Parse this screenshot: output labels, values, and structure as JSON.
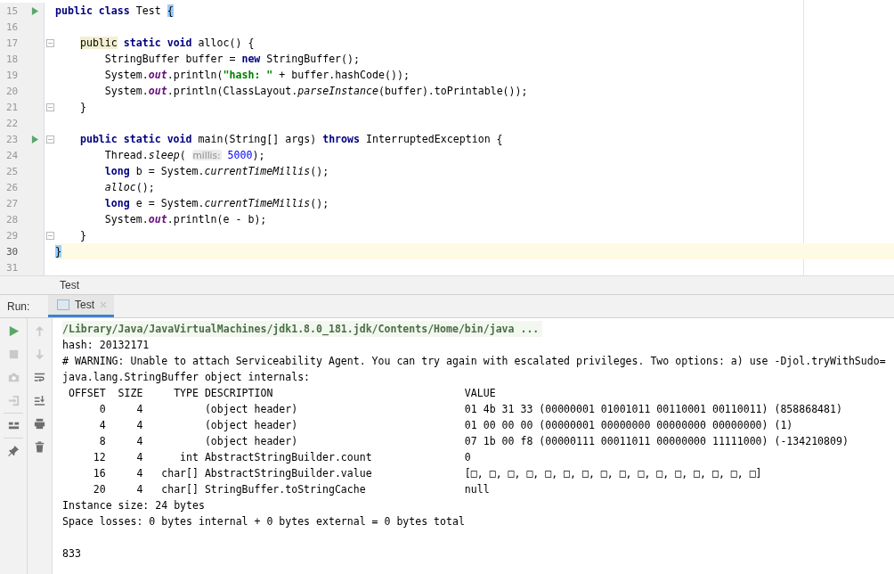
{
  "editor": {
    "lines": [
      {
        "number": "15",
        "run": true,
        "fold": false,
        "current": false,
        "segments": [
          {
            "kind": "kw",
            "text": "public class"
          },
          {
            "kind": "plain",
            "text": " Test "
          },
          {
            "kind": "match",
            "text": "{"
          }
        ]
      },
      {
        "number": "16",
        "run": false,
        "fold": false,
        "current": false
      },
      {
        "number": "17",
        "run": false,
        "fold": true,
        "current": false,
        "segments": [
          {
            "kind": "usage",
            "text": "    public"
          },
          {
            "kind": "kw",
            "text": " static void"
          },
          {
            "kind": "plain",
            "text": " alloc() {"
          }
        ]
      },
      {
        "number": "18",
        "run": false,
        "fold": false,
        "current": false,
        "segments": [
          {
            "kind": "plain",
            "text": "        StringBuffer buffer = "
          },
          {
            "kind": "kw",
            "text": "new"
          },
          {
            "kind": "plain",
            "text": " StringBuffer();"
          }
        ]
      },
      {
        "number": "19",
        "run": false,
        "fold": false,
        "current": false,
        "segments": [
          {
            "kind": "plain",
            "text": "        System."
          },
          {
            "kind": "field",
            "text": "out"
          },
          {
            "kind": "plain",
            "text": ".println("
          },
          {
            "kind": "str",
            "text": "\"hash: \""
          },
          {
            "kind": "plain",
            "text": " + buffer.hashCode());"
          }
        ]
      },
      {
        "number": "20",
        "run": false,
        "fold": false,
        "current": false,
        "segments": [
          {
            "kind": "plain",
            "text": "        System."
          },
          {
            "kind": "field",
            "text": "out"
          },
          {
            "kind": "plain",
            "text": ".println(ClassLayout."
          },
          {
            "kind": "italic",
            "text": "parseInstance"
          },
          {
            "kind": "plain",
            "text": "(buffer).toPrintable());"
          }
        ]
      },
      {
        "number": "21",
        "run": false,
        "fold": true,
        "current": false,
        "segments": [
          {
            "kind": "plain",
            "text": "    }"
          }
        ]
      },
      {
        "number": "22",
        "run": false,
        "fold": false,
        "current": false
      },
      {
        "number": "23",
        "run": true,
        "fold": true,
        "current": false,
        "segments": [
          {
            "kind": "kw",
            "text": "    public static void"
          },
          {
            "kind": "plain",
            "text": " main(String[] args) "
          },
          {
            "kind": "kw",
            "text": "throws"
          },
          {
            "kind": "plain",
            "text": " InterruptedException {"
          }
        ]
      },
      {
        "number": "24",
        "run": false,
        "fold": false,
        "current": false,
        "segments": [
          {
            "kind": "plain",
            "text": "        Thread."
          },
          {
            "kind": "italic",
            "text": "sleep"
          },
          {
            "kind": "plain",
            "text": "( "
          },
          {
            "kind": "hint",
            "text": "millis:"
          },
          {
            "kind": "num",
            "text": " 5000"
          },
          {
            "kind": "plain",
            "text": ");"
          }
        ]
      },
      {
        "number": "25",
        "run": false,
        "fold": false,
        "current": false,
        "segments": [
          {
            "kind": "kw",
            "text": "        long"
          },
          {
            "kind": "plain",
            "text": " b = System."
          },
          {
            "kind": "italic",
            "text": "currentTimeMillis"
          },
          {
            "kind": "plain",
            "text": "();"
          }
        ]
      },
      {
        "number": "26",
        "run": false,
        "fold": false,
        "current": false,
        "segments": [
          {
            "kind": "italic",
            "text": "        alloc"
          },
          {
            "kind": "plain",
            "text": "();"
          }
        ]
      },
      {
        "number": "27",
        "run": false,
        "fold": false,
        "current": false,
        "segments": [
          {
            "kind": "kw",
            "text": "        long"
          },
          {
            "kind": "plain",
            "text": " e = System."
          },
          {
            "kind": "italic",
            "text": "currentTimeMillis"
          },
          {
            "kind": "plain",
            "text": "();"
          }
        ]
      },
      {
        "number": "28",
        "run": false,
        "fold": false,
        "current": false,
        "segments": [
          {
            "kind": "plain",
            "text": "        System."
          },
          {
            "kind": "field",
            "text": "out"
          },
          {
            "kind": "plain",
            "text": ".println(e - b);"
          }
        ]
      },
      {
        "number": "29",
        "run": false,
        "fold": true,
        "current": false,
        "segments": [
          {
            "kind": "plain",
            "text": "    }"
          }
        ]
      },
      {
        "number": "30",
        "run": false,
        "fold": false,
        "current": true,
        "segments": [
          {
            "kind": "match",
            "text": "}"
          }
        ]
      },
      {
        "number": "31",
        "run": false,
        "fold": false,
        "current": false
      }
    ]
  },
  "breadcrumb": "Test",
  "run_panel": {
    "label": "Run:",
    "tabs": [
      {
        "label": "Test",
        "selected": true,
        "closable": true
      }
    ],
    "console": [
      {
        "kind": "command",
        "text": "/Library/Java/JavaVirtualMachines/jdk1.8.0_181.jdk/Contents/Home/bin/java ..."
      },
      {
        "kind": "output",
        "text": "hash: 20132171"
      },
      {
        "kind": "output",
        "text": "# WARNING: Unable to attach Serviceability Agent. You can try again with escalated privileges. Two options: a) use -Djol.tryWithSudo="
      },
      {
        "kind": "output",
        "text": "java.lang.StringBuffer object internals:"
      },
      {
        "kind": "output",
        "text": " OFFSET  SIZE     TYPE DESCRIPTION                               VALUE"
      },
      {
        "kind": "output",
        "text": "      0     4          (object header)                           01 4b 31 33 (00000001 01001011 00110001 00110011) (858868481)"
      },
      {
        "kind": "output",
        "text": "      4     4          (object header)                           01 00 00 00 (00000001 00000000 00000000 00000000) (1)"
      },
      {
        "kind": "output",
        "text": "      8     4          (object header)                           07 1b 00 f8 (00000111 00011011 00000000 11111000) (-134210809)"
      },
      {
        "kind": "output",
        "text": "     12     4      int AbstractStringBuilder.count               0"
      },
      {
        "kind": "output",
        "text": "     16     4   char[] AbstractStringBuilder.value               [□, □, □, □, □, □, □, □, □, □, □, □, □, □, □, □]"
      },
      {
        "kind": "output",
        "text": "     20     4   char[] StringBuffer.toStringCache                null"
      },
      {
        "kind": "output",
        "text": "Instance size: 24 bytes"
      },
      {
        "kind": "output",
        "text": "Space losses: 0 bytes internal + 0 bytes external = 0 bytes total"
      },
      {
        "kind": "output",
        "text": "833",
        "gap_before": true
      }
    ]
  }
}
